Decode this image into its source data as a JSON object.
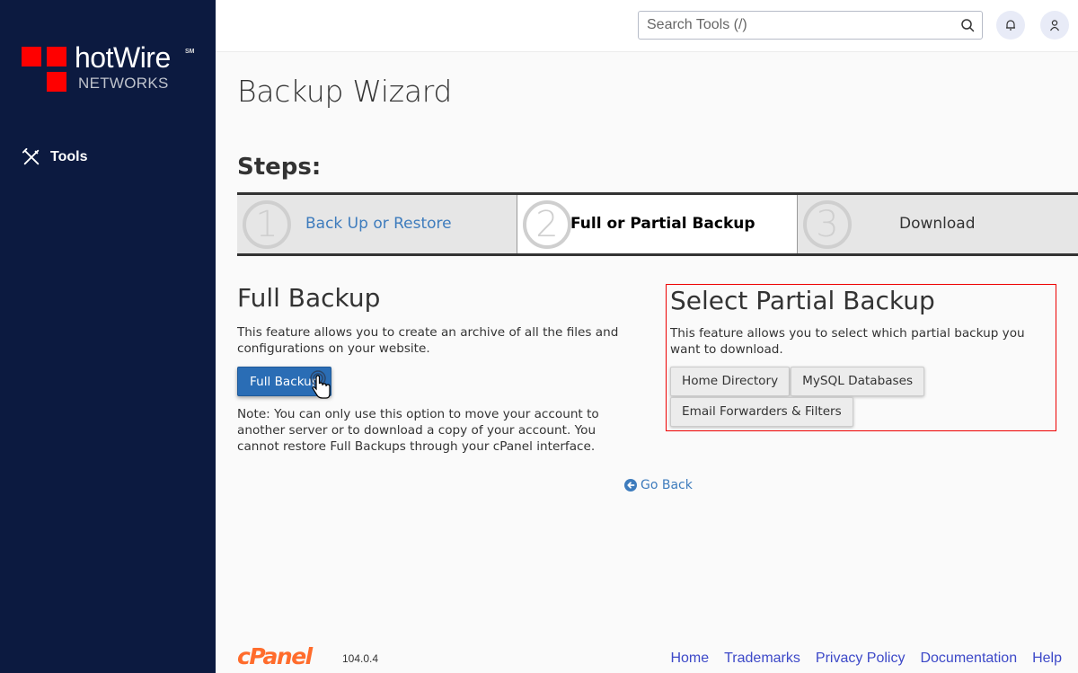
{
  "brand": {
    "name": "hotWire",
    "trademark": "SM",
    "subtitle": "NETWORKS"
  },
  "sidebar": {
    "items": [
      {
        "label": "Tools",
        "icon": "tools-icon"
      }
    ]
  },
  "topbar": {
    "search_placeholder": "Search Tools (/)",
    "search_value": "",
    "notifications_icon": "bell-icon",
    "user_icon": "user-icon"
  },
  "page": {
    "title": "Backup Wizard",
    "steps_heading": "Steps:",
    "steps": [
      {
        "number": "1",
        "label": "Back Up or Restore",
        "state": "link"
      },
      {
        "number": "2",
        "label": "Full or Partial Backup",
        "state": "active"
      },
      {
        "number": "3",
        "label": "Download",
        "state": "inactive"
      }
    ]
  },
  "full_backup": {
    "heading": "Full Backup",
    "description": "This feature allows you to create an archive of all the files and configurations on your website.",
    "button_label": "Full Backup",
    "note": "Note: You can only use this option to move your account to another server or to download a copy of your account. You cannot restore Full Backups through your cPanel interface."
  },
  "partial_backup": {
    "heading": "Select Partial Backup",
    "description": "This feature allows you to select which partial backup you want to download.",
    "buttons": [
      {
        "label": "Home Directory"
      },
      {
        "label": "MySQL Databases"
      },
      {
        "label": "Email Forwarders & Filters"
      }
    ],
    "highlight_color": "#e00000"
  },
  "go_back": {
    "label": "Go Back"
  },
  "footer": {
    "logo_text": "cPanel",
    "version": "104.0.4",
    "links": [
      "Home",
      "Trademarks",
      "Privacy Policy",
      "Documentation",
      "Help"
    ]
  },
  "colors": {
    "sidebar_bg": "#0c1a40",
    "brand_red": "#ff0000",
    "primary_button": "#2a6db5",
    "link": "#3e7cbd",
    "cpanel_orange": "#ff6c2c",
    "footer_link": "#3d49c8"
  }
}
